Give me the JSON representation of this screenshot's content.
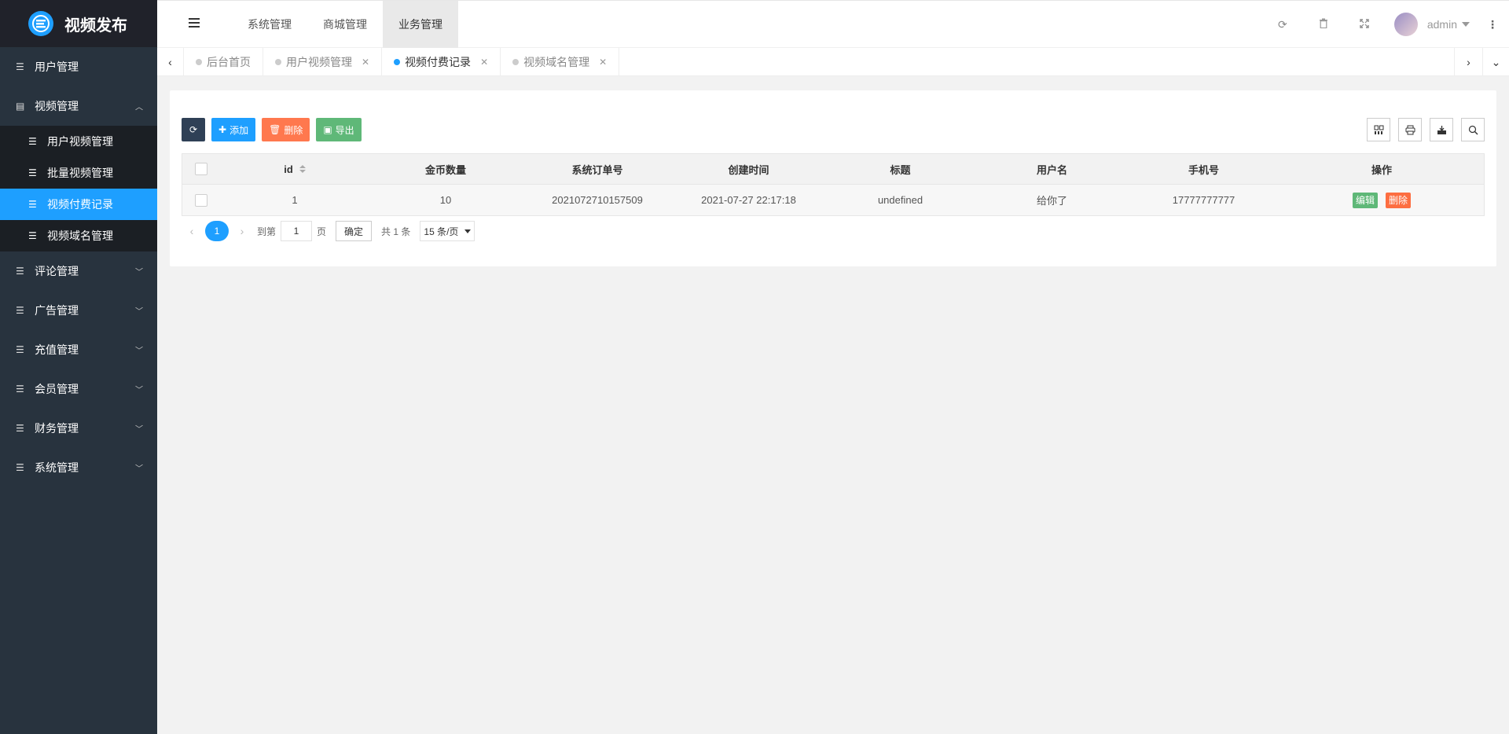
{
  "logo": {
    "text": "视频发布"
  },
  "sidebar": {
    "items": [
      {
        "label": "用户管理"
      },
      {
        "label": "视频管理",
        "expanded": true,
        "children": [
          {
            "label": "用户视频管理"
          },
          {
            "label": "批量视频管理"
          },
          {
            "label": "视频付费记录",
            "active": true
          },
          {
            "label": "视频域名管理"
          }
        ]
      },
      {
        "label": "评论管理"
      },
      {
        "label": "广告管理"
      },
      {
        "label": "充值管理"
      },
      {
        "label": "会员管理"
      },
      {
        "label": "财务管理"
      },
      {
        "label": "系统管理"
      }
    ]
  },
  "header": {
    "menu": [
      {
        "label": "系统管理"
      },
      {
        "label": "商城管理"
      },
      {
        "label": "业务管理",
        "active": true
      }
    ],
    "username": "admin"
  },
  "tabs": [
    {
      "label": "后台首页"
    },
    {
      "label": "用户视频管理"
    },
    {
      "label": "视频付费记录",
      "active": true
    },
    {
      "label": "视频域名管理"
    }
  ],
  "toolbar": {
    "add_label": "添加",
    "delete_label": "删除",
    "export_label": "导出"
  },
  "table": {
    "columns": [
      "id",
      "金币数量",
      "系统订单号",
      "创建时间",
      "标题",
      "用户名",
      "手机号",
      "操作"
    ],
    "rows": [
      {
        "id": "1",
        "coins": "10",
        "order_no": "2021072710157509",
        "created": "2021-07-27 22:17:18",
        "title": "undefined",
        "username": "给你了",
        "phone": "17777777777",
        "edit_label": "编辑",
        "delete_label": "删除"
      }
    ]
  },
  "pager": {
    "current": "1",
    "goto_label": "到第",
    "goto_value": "1",
    "page_label": "页",
    "confirm_label": "确定",
    "total_label": "共 1 条",
    "per_page": "15 条/页"
  },
  "colors": {
    "accent": "#1e9fff",
    "sidebar_bg": "#28333e",
    "logo_bg": "#20222a",
    "success": "#5fb878",
    "danger": "#ff5722"
  }
}
